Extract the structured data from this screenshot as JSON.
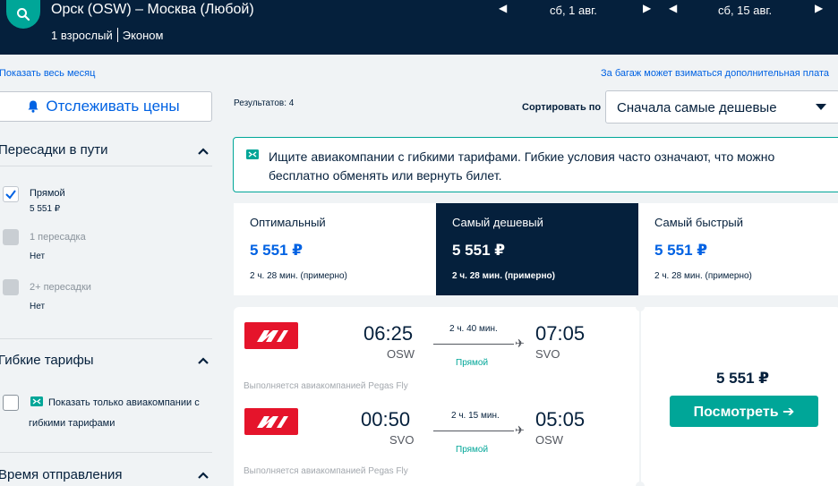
{
  "header": {
    "route": "Орск (OSW) – Москва (Любой)",
    "passengers": "1 взрослый",
    "cabin": "Эконом",
    "depart_date": "сб, 1 авг.",
    "return_date": "сб, 15 авг."
  },
  "links": {
    "show_month": "Показать весь месяц",
    "baggage": "За багаж может взиматься дополнительная плата"
  },
  "sidebar": {
    "track_label": "Отслеживать цены",
    "stops_title": "Пересадки в пути",
    "stops": [
      {
        "label": "Прямой",
        "price": "5 551 ₽",
        "checked": true
      },
      {
        "label": "1 пересадка",
        "price": "Нет",
        "checked": false
      },
      {
        "label": "2+ пересадки",
        "price": "Нет",
        "checked": false
      }
    ],
    "flex_title": "Гибкие тарифы",
    "flex_label": "Показать только авиакомпании с гибкими тарифами",
    "departure_title": "Время отправления"
  },
  "main": {
    "results": "Результатов: 4",
    "sort_label": "Сортировать по",
    "sort_value": "Сначала самые дешевые",
    "notice": "Ищите авиакомпании с гибкими тарифами. Гибкие условия часто означают, что можно бесплатно обменять или вернуть билет.",
    "tabs": [
      {
        "name": "Оптимальный",
        "price": "5 551 ₽",
        "duration": "2 ч. 28 мин. (примерно)"
      },
      {
        "name": "Самый дешевый",
        "price": "5 551 ₽",
        "duration": "2 ч. 28 мин. (примерно)"
      },
      {
        "name": "Самый быстрый",
        "price": "5 551 ₽",
        "duration": "2 ч. 28 мин. (примерно)"
      }
    ],
    "legs": [
      {
        "dep_time": "06:25",
        "dep_code": "OSW",
        "arr_time": "07:05",
        "arr_code": "SVO",
        "duration": "2 ч. 40 мин.",
        "stops": "Прямой",
        "operated": "Выполняется авиакомпанией Pegas Fly"
      },
      {
        "dep_time": "00:50",
        "dep_code": "SVO",
        "arr_time": "05:05",
        "arr_code": "OSW",
        "duration": "2 ч. 15 мин.",
        "stops": "Прямой",
        "operated": "Выполняется авиакомпанией Pegas Fly"
      }
    ],
    "price": "5 551 ₽",
    "view_label": "Посмотреть ➔"
  },
  "colors": {
    "navy": "#05203c",
    "teal": "#00a698",
    "blue": "#0062e3",
    "airline_red": "#e5142b"
  }
}
